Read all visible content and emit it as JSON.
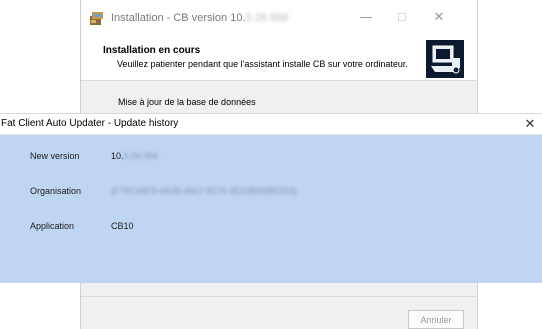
{
  "installer": {
    "title_prefix": "Installation - CB version 10.",
    "title_blurred": "5.26.956",
    "minimize_icon": "—",
    "maximize_icon": "☐",
    "close_icon": "✕",
    "heading": "Installation en cours",
    "subheading": "Veuillez patienter pendant que l'assistant installe CB sur votre ordinateur.",
    "status": "Mise à jour de la base de données",
    "cancel_label": "Annuler"
  },
  "updater": {
    "title": "Fat Client Auto Updater - Update history",
    "close_icon": "✕",
    "fields": [
      {
        "label": "New version",
        "value_prefix": "10.",
        "value_blurred": "5.26.956"
      },
      {
        "label": "Organisation",
        "value_prefix": "",
        "value_blurred": "{F79C48F9-4A38-4667-8076-3E53B96BE553}"
      },
      {
        "label": "Application",
        "value_prefix": "CB10",
        "value_blurred": ""
      }
    ]
  },
  "colors": {
    "updater_background": "#bfd6f3",
    "installer_background": "#f0f0f0"
  },
  "icons": {
    "installer_app": "installer-package-icon",
    "installer_logo": "computer-install-icon"
  }
}
